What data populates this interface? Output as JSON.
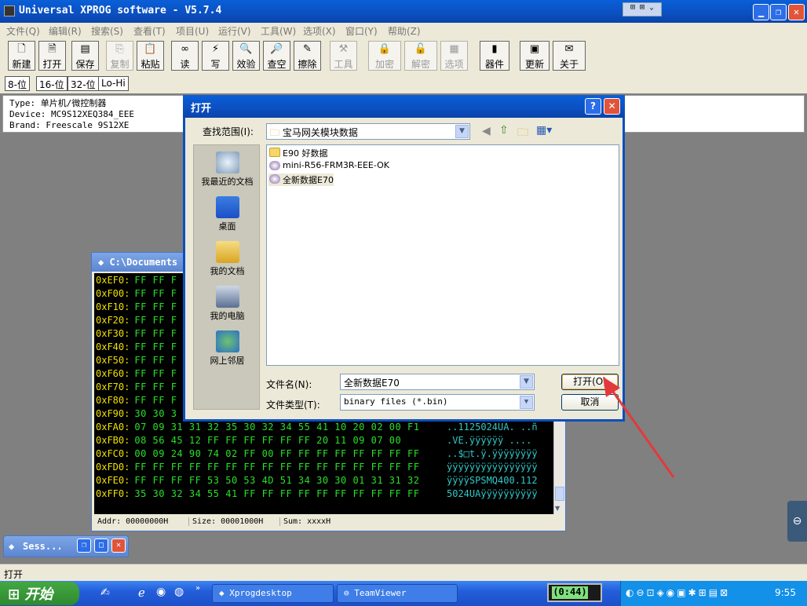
{
  "app": {
    "title": "Universal XPROG software - V5.7.4",
    "menu": [
      "文件(Q)",
      "编辑(R)",
      "搜索(S)",
      "查看(T)",
      "项目(U)",
      "运行(V)",
      "工具(W)",
      "选项(X)",
      "窗口(Y)",
      "帮助(Z)"
    ],
    "toolbar": [
      {
        "label": "新建",
        "icon": "new-file-icon",
        "enabled": true
      },
      {
        "label": "打开",
        "icon": "open-file-icon",
        "enabled": true
      },
      {
        "label": "保存",
        "icon": "save-icon",
        "enabled": true
      },
      {
        "label": "复制",
        "icon": "copy-icon",
        "enabled": false
      },
      {
        "label": "粘贴",
        "icon": "paste-icon",
        "enabled": true
      },
      {
        "label": "读",
        "icon": "read-icon",
        "enabled": true
      },
      {
        "label": "写",
        "icon": "write-icon",
        "enabled": true
      },
      {
        "label": "效验",
        "icon": "verify-icon",
        "enabled": true
      },
      {
        "label": "查空",
        "icon": "blank-check-icon",
        "enabled": true
      },
      {
        "label": "擦除",
        "icon": "erase-icon",
        "enabled": true
      },
      {
        "label": "工具",
        "icon": "tools-icon",
        "enabled": false
      },
      {
        "label": "加密",
        "icon": "lock-icon",
        "enabled": false
      },
      {
        "label": "解密",
        "icon": "unlock-icon",
        "enabled": false
      },
      {
        "label": "选项",
        "icon": "options-icon",
        "enabled": false
      },
      {
        "label": "器件",
        "icon": "device-icon",
        "enabled": true
      },
      {
        "label": "更新",
        "icon": "update-icon",
        "enabled": true
      },
      {
        "label": "关于",
        "icon": "about-icon",
        "enabled": true
      }
    ],
    "bit_buttons": [
      "8-位",
      "16-位",
      "32-位",
      "Lo-Hi"
    ],
    "info": {
      "type": "Type: 单片机/微控制器",
      "device": "Device: MC9S12XEQ384_EEE",
      "brand": "Brand: Freescale 9S12XE"
    },
    "status_text": "打开"
  },
  "hex_window": {
    "title": "C:\\Documents",
    "rows": [
      {
        "addr": "0xEF0:",
        "bytes": "FF FF F",
        "ascii": ""
      },
      {
        "addr": "0xF00:",
        "bytes": "FF FF F",
        "ascii": ""
      },
      {
        "addr": "0xF10:",
        "bytes": "FF FF F",
        "ascii": ""
      },
      {
        "addr": "0xF20:",
        "bytes": "FF FF F",
        "ascii": ""
      },
      {
        "addr": "0xF30:",
        "bytes": "FF FF F",
        "ascii": ""
      },
      {
        "addr": "0xF40:",
        "bytes": "FF FF F",
        "ascii": ""
      },
      {
        "addr": "0xF50:",
        "bytes": "FF FF F",
        "ascii": ""
      },
      {
        "addr": "0xF60:",
        "bytes": "FF FF F",
        "ascii": ""
      },
      {
        "addr": "0xF70:",
        "bytes": "FF FF F",
        "ascii": ""
      },
      {
        "addr": "0xF80:",
        "bytes": "FF FF F",
        "ascii": ""
      },
      {
        "addr": "0xF90:",
        "bytes": "30 30 3",
        "ascii": ""
      },
      {
        "addr": "0xFA0:",
        "bytes": "07 09 31 31 32 35 30 32 34 55 41 10 20 02 00 F1",
        "ascii": "..1125024UA. ..ñ"
      },
      {
        "addr": "0xFB0:",
        "bytes": "08 56 45 12 FF FF FF FF FF FF 20 11 09 07 00",
        "ascii": ".VE.ÿÿÿÿÿÿ ...."
      },
      {
        "addr": "0xFC0:",
        "bytes": "00 09 24 90 74 02 FF 00 FF FF FF FF FF FF FF FF",
        "ascii": "..$□t.ÿ.ÿÿÿÿÿÿÿÿ"
      },
      {
        "addr": "0xFD0:",
        "bytes": "FF FF FF FF FF FF FF FF FF FF FF FF FF FF FF FF",
        "ascii": "ÿÿÿÿÿÿÿÿÿÿÿÿÿÿÿÿ"
      },
      {
        "addr": "0xFE0:",
        "bytes": "FF FF FF FF 53 50 53 4D 51 34 30 30 01 31 31 32",
        "ascii": "ÿÿÿÿSPSMQ400.112"
      },
      {
        "addr": "0xFF0:",
        "bytes": "35 30 32 34 55 41 FF FF FF FF FF FF FF FF FF FF",
        "ascii": "5024UAÿÿÿÿÿÿÿÿÿÿ"
      }
    ],
    "status": {
      "addr": "Addr: 00000000H",
      "size": "Size: 00001000H",
      "sum": "Sum: xxxxH"
    }
  },
  "session_window": {
    "title": "Sess..."
  },
  "dialog": {
    "title": "打开",
    "look_in_label": "查找范围(I):",
    "look_in_value": "宝马网关模块数据",
    "places": [
      "我最近的文档",
      "桌面",
      "我的文档",
      "我的电脑",
      "网上邻居"
    ],
    "files": [
      "E90 好数据",
      "mini-R56-FRM3R-EEE-OK",
      "全新数据E70"
    ],
    "filename_label": "文件名(N):",
    "filename_value": "全新数据E70",
    "filetype_label": "文件类型(T):",
    "filetype_value": "binary files (*.bin)",
    "open_button": "打开(O)",
    "cancel_button": "取消"
  },
  "taskbar": {
    "start": "开始",
    "tasks": [
      "Xprogdesktop",
      "TeamViewer"
    ],
    "timer": "(0:44)",
    "clock": "9:55"
  },
  "colors": {
    "title_blue": "#0b4fc0",
    "hex_address": "#f0e000",
    "hex_bytes": "#28e028",
    "hex_ascii": "#30c8c8",
    "annotation_arrow": "#e23a3a"
  }
}
